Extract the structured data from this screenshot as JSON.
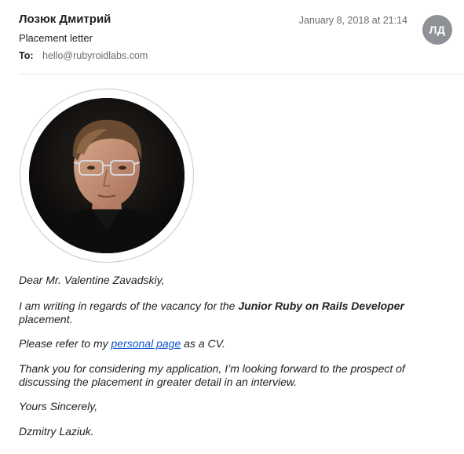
{
  "header": {
    "sender_name": "Лозюк Дмитрий",
    "date": "January 8, 2018 at 21:14",
    "subject": "Placement letter",
    "to_label": "To:",
    "to_address": "hello@rubyroidlabs.com",
    "avatar_initials": "ЛД"
  },
  "body": {
    "greeting": "Dear Mr. Valentine Zavadskiy,",
    "p2_before": "I am writing in regards of the vacancy for the ",
    "p2_bold": "Junior Ruby on Rails Developer",
    "p2_after": " placement.",
    "p3_before": "Please refer to my ",
    "p3_link": "personal page",
    "p3_after": " as a CV.",
    "p4": "Thank you for considering my application, I’m looking forward to the prospect of discussing the placement in greater detail in an interview.",
    "closing": "Yours Sincerely,",
    "signature": "Dzmitry Laziuk."
  },
  "colors": {
    "link": "#1155cc",
    "avatar_bg": "#8e9196",
    "muted_text": "#6b6b6b"
  }
}
